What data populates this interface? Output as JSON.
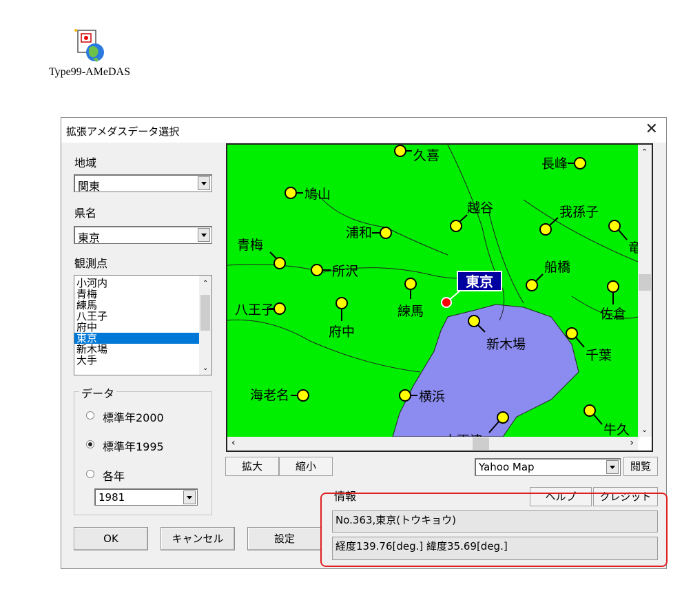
{
  "desktop": {
    "icon_label": "Type99-AMeDAS"
  },
  "dialog": {
    "title": "拡張アメダスデータ選択",
    "region": {
      "label": "地域",
      "value": "関東"
    },
    "prefecture": {
      "label": "県名",
      "value": "東京"
    },
    "stations": {
      "label": "観測点",
      "items": [
        "小河内",
        "青梅",
        "練馬",
        "八王子",
        "府中",
        "東京",
        "新木場",
        "大手"
      ],
      "selected": "東京"
    },
    "data_group": {
      "label": "データ",
      "options": [
        "標準年2000",
        "標準年1995",
        "各年"
      ],
      "selected": "標準年1995",
      "year": "1981"
    },
    "buttons": {
      "ok": "OK",
      "cancel": "キャンセル",
      "settings": "設定",
      "zoom_in": "拡大",
      "zoom_out": "縮小",
      "view": "閲覧",
      "help": "ヘルプ",
      "credit": "クレジット"
    },
    "map_source": "Yahoo Map",
    "info": {
      "label": "情報",
      "line1": "No.363,東京(トウキョウ)",
      "line2": "経度139.76[deg.] 緯度35.69[deg.]"
    },
    "map": {
      "selected_station": "東京",
      "stations": [
        "久喜",
        "長峰",
        "鳩山",
        "越谷",
        "我孫子",
        "浦和",
        "青梅",
        "所沢",
        "船橋",
        "練馬",
        "八王子",
        "府中",
        "佐倉",
        "新木場",
        "千葉",
        "海老名",
        "横浜",
        "牛久",
        "木更津",
        "竜"
      ],
      "colors": {
        "land": "#00ee00",
        "sea": "#8c8cf0",
        "marker": "#ffff00",
        "selected": "#ff0000",
        "label_bg": "#0000a0"
      }
    }
  }
}
